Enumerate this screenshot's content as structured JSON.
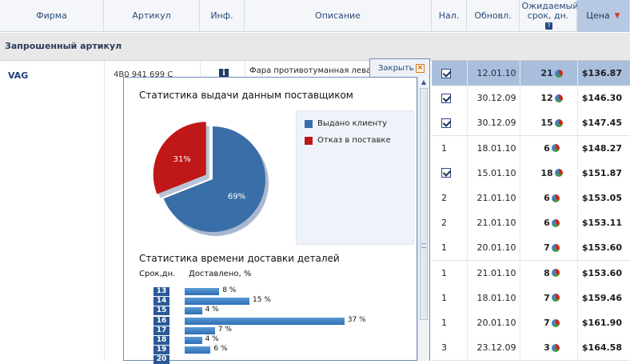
{
  "header": {
    "firm": "Фирма",
    "article": "Артикул",
    "info": "Инф.",
    "description": "Описание",
    "availability": "Нал.",
    "updated": "Обновл.",
    "expected_term": "Ожидаемый срок, дн.",
    "expected_help": "?",
    "price": "Цена"
  },
  "section_title": "Запрошенный артикул",
  "item": {
    "firm": "VAG",
    "article": "4B0 941 699 C",
    "info_icon": "i",
    "description": "Фара противотуманная левая"
  },
  "rows": [
    {
      "availability": "check",
      "updated": "12.01.10",
      "term": "21",
      "price": "$136.87"
    },
    {
      "availability": "check",
      "updated": "30.12.09",
      "term": "12",
      "price": "$146.30"
    },
    {
      "availability": "check",
      "updated": "30.12.09",
      "term": "15",
      "price": "$147.45"
    },
    {
      "availability": "1",
      "updated": "18.01.10",
      "term": "6",
      "price": "$148.27"
    },
    {
      "availability": "check",
      "updated": "15.01.10",
      "term": "18",
      "price": "$151.87"
    },
    {
      "availability": "2",
      "updated": "21.01.10",
      "term": "6",
      "price": "$153.05"
    },
    {
      "availability": "2",
      "updated": "21.01.10",
      "term": "6",
      "price": "$153.11"
    },
    {
      "availability": "1",
      "updated": "20.01.10",
      "term": "7",
      "price": "$153.60"
    },
    {
      "availability": "1",
      "updated": "21.01.10",
      "term": "8",
      "price": "$153.60"
    },
    {
      "availability": "1",
      "updated": "18.01.10",
      "term": "7",
      "price": "$159.46"
    },
    {
      "availability": "1",
      "updated": "20.01.10",
      "term": "7",
      "price": "$161.90"
    },
    {
      "availability": "3",
      "updated": "23.12.09",
      "term": "3",
      "price": "$164.58"
    }
  ],
  "popup": {
    "close_label": "Закрыть",
    "stats_title": "Статистика выдачи данным поставщиком",
    "time_title": "Статистика времени доставки деталей",
    "col_term": "Срок,дн.",
    "col_delivered": "Доставлено, %"
  },
  "colors": {
    "accent": "#2a4a78",
    "pie_issued": "#3a6ea8",
    "pie_refused": "#c01818",
    "bar": "#3a7fc4"
  },
  "chart_data": [
    {
      "type": "pie",
      "title": "Статистика выдачи данным поставщиком",
      "slices": [
        {
          "name": "Выдано клиенту",
          "value": 69,
          "label": "69%"
        },
        {
          "name": "Отказ в поставке",
          "value": 31,
          "label": "31%"
        }
      ],
      "legend": "right"
    },
    {
      "type": "bar",
      "title": "Статистика времени доставки деталей",
      "xlabel": "Срок,дн.",
      "ylabel": "Доставлено, %",
      "categories": [
        "13",
        "14",
        "15",
        "16",
        "17",
        "18",
        "19",
        "20"
      ],
      "values": [
        8,
        15,
        4,
        37,
        7,
        4,
        6,
        null
      ],
      "labels": [
        "8 %",
        "15 %",
        "4 %",
        "37 %",
        "7 %",
        "4 %",
        "6 %",
        ""
      ]
    }
  ]
}
